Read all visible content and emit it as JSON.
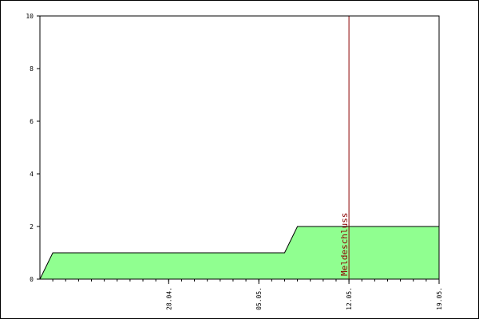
{
  "chart_data": {
    "type": "area",
    "title": "",
    "xlabel": "",
    "ylabel": "",
    "ylim": [
      0,
      10
    ],
    "y_ticks": [
      0,
      2,
      4,
      6,
      8,
      10
    ],
    "xlim": [
      "2022-04-18",
      "2022-05-19"
    ],
    "x_tick_dates": [
      "2022-04-28",
      "2022-05-05",
      "2022-05-12",
      "2022-05-19"
    ],
    "x_tick_labels": [
      "28.04.",
      "05.05.",
      "12.05.",
      "19.05."
    ],
    "series": [
      {
        "x": [
          "2022-04-18",
          "2022-04-19",
          "2022-05-02",
          "2022-05-07",
          "2022-05-08",
          "2022-05-19"
        ],
        "values": [
          0,
          1,
          1,
          1,
          2,
          2
        ]
      }
    ],
    "annotations": [
      {
        "x": "2022-05-12",
        "label": "Meldeschluss",
        "color": "#8b0000"
      }
    ],
    "colors": {
      "area_fill": "#90ff90",
      "area_stroke": "#000000",
      "axis": "#000000",
      "marker_line": "#8b0000"
    },
    "grid": false,
    "legend": "none"
  }
}
